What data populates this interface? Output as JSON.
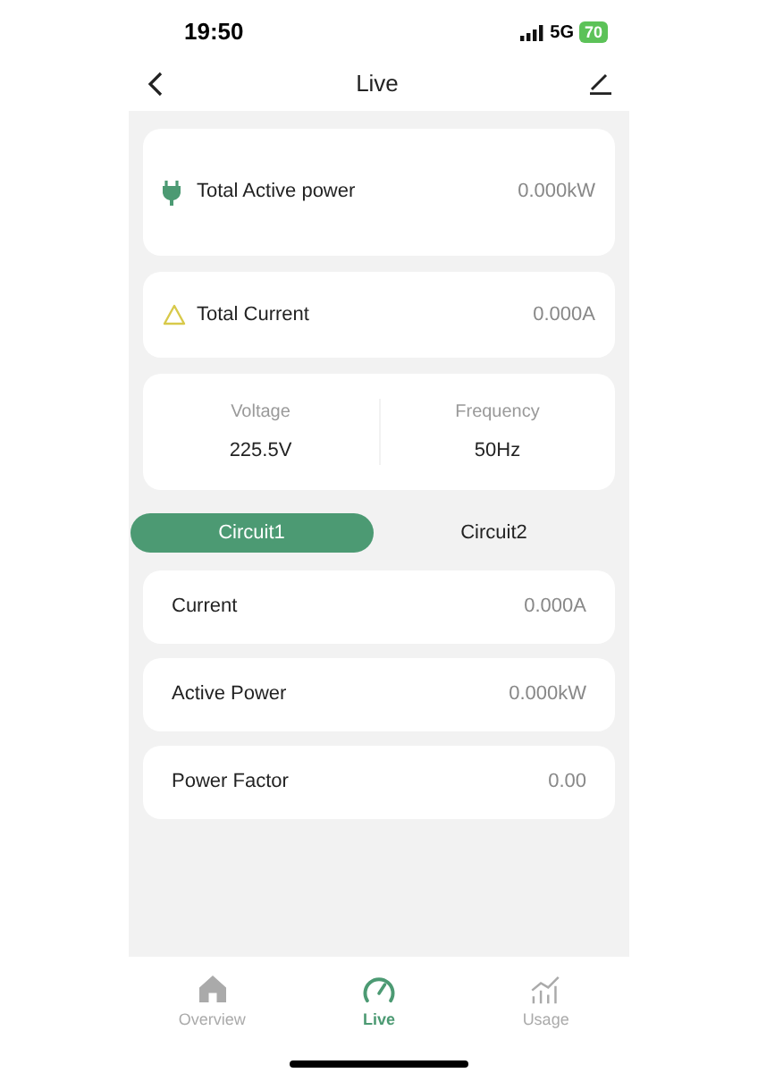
{
  "status_bar": {
    "time": "19:50",
    "network": "5G",
    "battery": "70"
  },
  "header": {
    "title": "Live"
  },
  "totals": [
    {
      "kind": "power",
      "label": "Total Active power",
      "value": "0.000kW"
    },
    {
      "kind": "current",
      "label": "Total Current",
      "value": "0.000A"
    }
  ],
  "grid": [
    {
      "label": "Voltage",
      "value": "225.5V"
    },
    {
      "label": "Frequency",
      "value": "50Hz"
    }
  ],
  "circuit_tabs": [
    {
      "label": "Circuit1",
      "selected": true
    },
    {
      "label": "Circuit2",
      "selected": false
    }
  ],
  "readings": [
    {
      "label": "Current",
      "value": "0.000A"
    },
    {
      "label": "Active Power",
      "value": "0.000kW"
    },
    {
      "label": "Power Factor",
      "value": "0.00"
    }
  ],
  "nav": [
    {
      "kind": "home",
      "label": "Overview",
      "selected": false
    },
    {
      "kind": "gauge",
      "label": "Live",
      "selected": true
    },
    {
      "kind": "chart",
      "label": "Usage",
      "selected": false
    }
  ]
}
